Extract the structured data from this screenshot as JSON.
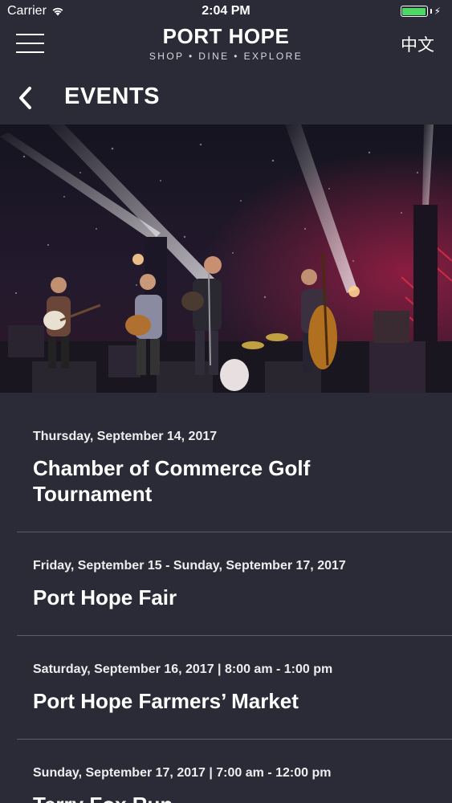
{
  "status_bar": {
    "carrier": "Carrier",
    "time": "2:04 PM"
  },
  "header": {
    "brand_title": "PORT HOPE",
    "brand_tagline": "SHOP • DINE • EXPLORE",
    "language_toggle": "中文",
    "menu_icon": "hamburger-icon"
  },
  "page": {
    "title": "EVENTS",
    "back_icon": "chevron-left-icon"
  },
  "hero": {
    "description_icon": "concert-photo"
  },
  "events": [
    {
      "date": "Thursday, September 14, 2017",
      "title": "Chamber of Commerce Golf Tournament"
    },
    {
      "date": "Friday, September 15 - Sunday, September 17, 2017",
      "title": "Port Hope Fair"
    },
    {
      "date": "Saturday, September 16, 2017 | 8:00 am - 1:00 pm",
      "title": "Port Hope Farmers’ Market"
    },
    {
      "date": "Sunday, September 17, 2017 | 7:00 am - 12:00 pm",
      "title": "Terry Fox Run"
    }
  ],
  "colors": {
    "background": "#2b2b38",
    "battery": "#4cd964",
    "divider": "#5c5c68"
  }
}
